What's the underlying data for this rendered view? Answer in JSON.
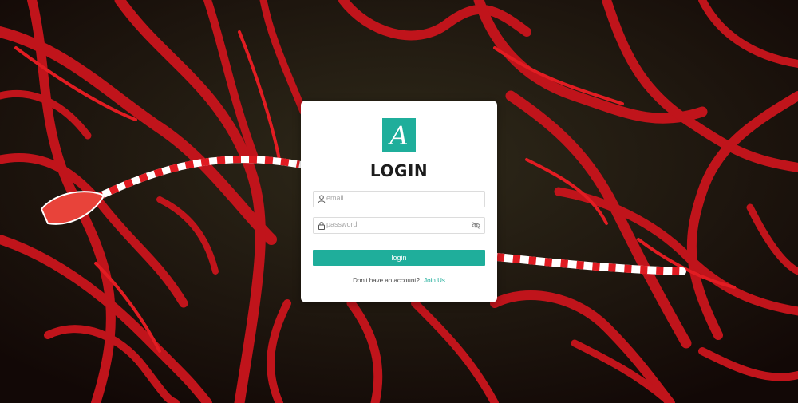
{
  "background": {
    "description_icon": "red-coral-pipefish-photo"
  },
  "login_card": {
    "logo_letter": "A",
    "title": "LOGIN",
    "email": {
      "placeholder": "email",
      "icon": "user-icon"
    },
    "password": {
      "placeholder": "password",
      "icon": "lock-icon",
      "toggle_icon": "eye-slash-icon"
    },
    "submit_label": "login",
    "footer_text": "Don't have an account?",
    "footer_link": "Join Us"
  },
  "colors": {
    "accent": "#1fae9b",
    "card": "#ffffff",
    "title": "#1c1c1c"
  }
}
